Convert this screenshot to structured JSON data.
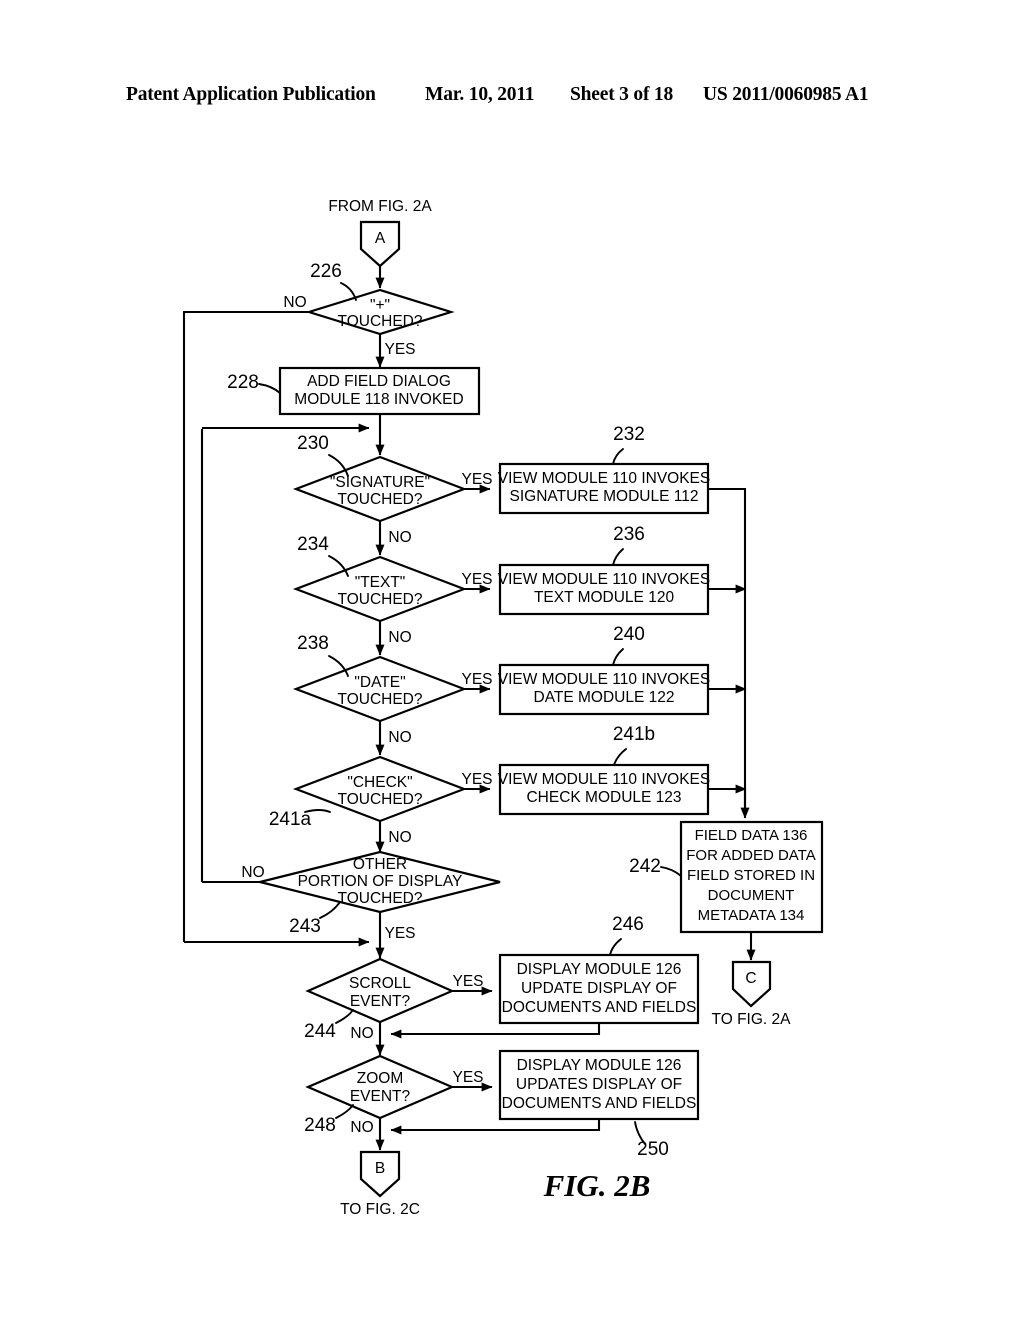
{
  "header": {
    "title": "Patent Application Publication",
    "date": "Mar. 10, 2011",
    "sheet": "Sheet 3 of 18",
    "publication_number": "US 2011/0060985 A1"
  },
  "figure": {
    "label": "FIG. 2B"
  },
  "connectors": {
    "a": {
      "letter": "A",
      "caption": "FROM FIG. 2A"
    },
    "b": {
      "letter": "B",
      "caption": "TO FIG. 2C"
    },
    "c": {
      "letter": "C",
      "caption": "TO FIG. 2A"
    }
  },
  "decisions": {
    "plus": {
      "ref": "226",
      "line1": "\"+\"",
      "line2": "TOUCHED?"
    },
    "signature": {
      "ref": "230",
      "line1": "\"SIGNATURE\"",
      "line2": "TOUCHED?"
    },
    "text": {
      "ref": "234",
      "line1": "\"TEXT\"",
      "line2": "TOUCHED?"
    },
    "date": {
      "ref": "238",
      "line1": "\"DATE\"",
      "line2": "TOUCHED?"
    },
    "check": {
      "ref": "241a",
      "line1": "\"CHECK\"",
      "line2": "TOUCHED?"
    },
    "other": {
      "ref": "243",
      "line1": "OTHER",
      "line2": "PORTION OF DISPLAY",
      "line3": "TOUCHED?"
    },
    "scroll": {
      "ref": "244",
      "line1": "SCROLL",
      "line2": "EVENT?"
    },
    "zoom": {
      "ref": "248",
      "line1": "ZOOM",
      "line2": "EVENT?"
    }
  },
  "processes": {
    "add_field_dialog": {
      "ref": "228",
      "line1": "ADD FIELD DIALOG",
      "line2": "MODULE 118 INVOKED"
    },
    "signature_module": {
      "ref": "232",
      "line1": "VIEW MODULE 110 INVOKES",
      "line2": "SIGNATURE MODULE 112"
    },
    "text_module": {
      "ref": "236",
      "line1": "VIEW MODULE 110 INVOKES",
      "line2": "TEXT MODULE 120"
    },
    "date_module": {
      "ref": "240",
      "line1": "VIEW MODULE 110 INVOKES",
      "line2": "DATE MODULE 122"
    },
    "check_module": {
      "ref": "241b",
      "line1": "VIEW MODULE 110 INVOKES",
      "line2": "CHECK MODULE 123"
    },
    "field_data": {
      "ref": "242",
      "line1": "FIELD DATA 136",
      "line2": "FOR ADDED DATA",
      "line3": "FIELD STORED IN",
      "line4": "DOCUMENT",
      "line5": "METADATA 134"
    },
    "scroll_display": {
      "ref": "246",
      "line1": "DISPLAY MODULE 126",
      "line2": "UPDATE DISPLAY OF",
      "line3": "DOCUMENTS AND FIELDS"
    },
    "zoom_display": {
      "ref": "250",
      "line1": "DISPLAY MODULE 126",
      "line2": "UPDATES DISPLAY OF",
      "line3": "DOCUMENTS AND FIELDS"
    }
  },
  "edge_labels": {
    "yes": "YES",
    "no": "NO"
  }
}
